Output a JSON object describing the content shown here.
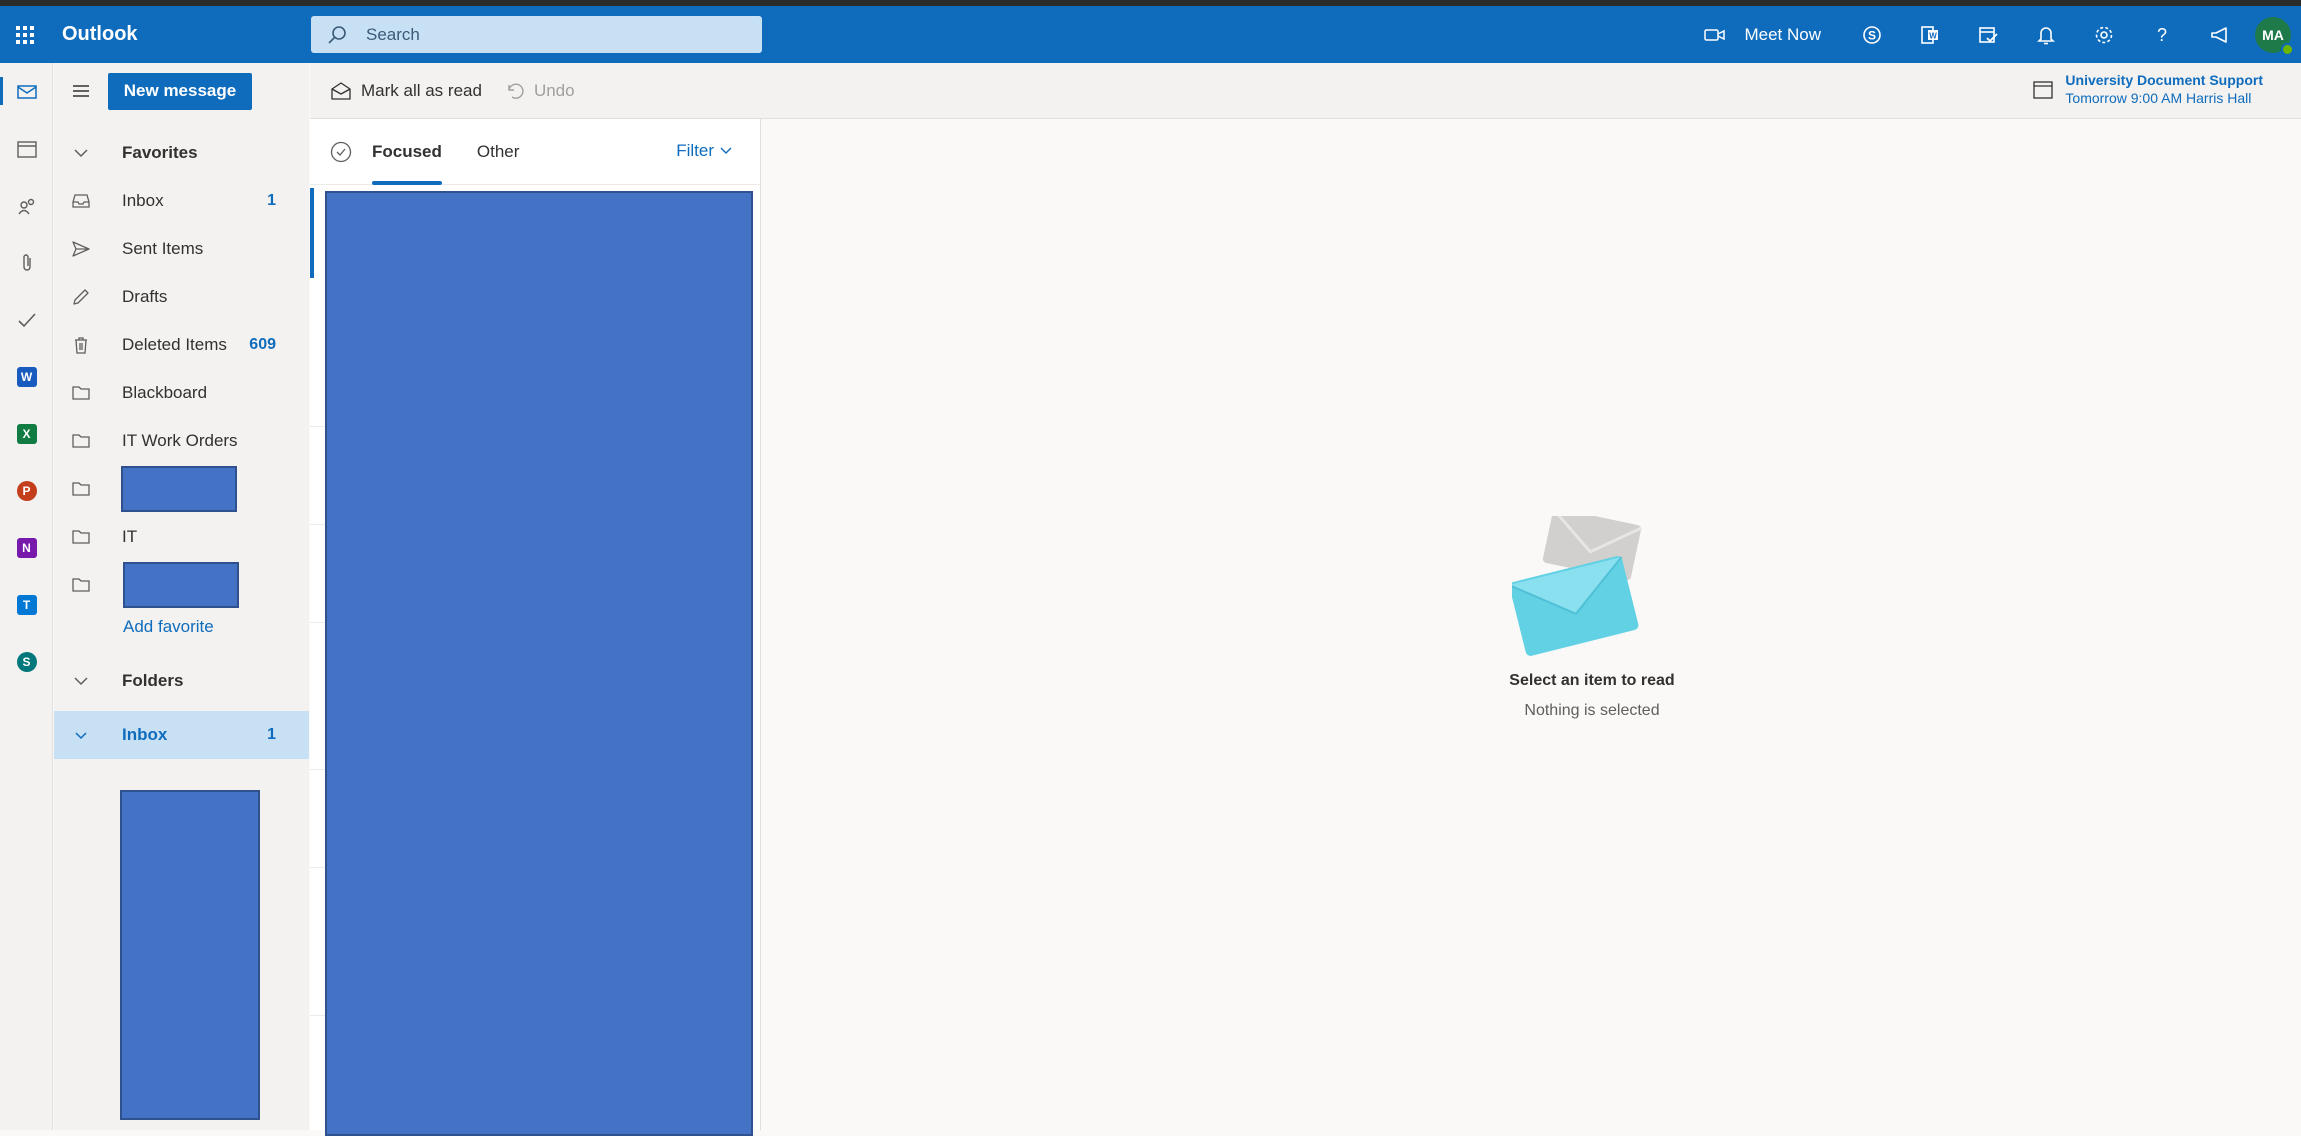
{
  "app": {
    "title": "Outlook"
  },
  "search": {
    "placeholder": "Search"
  },
  "topbar": {
    "meet_now_label": "Meet Now",
    "avatar_initials": "MA"
  },
  "toolbar": {
    "new_message_label": "New message",
    "mark_all_read_label": "Mark all as read",
    "undo_label": "Undo"
  },
  "reminder": {
    "title": "University Document Support",
    "detail": "Tomorrow 9:00 AM Harris Hall"
  },
  "favorites": {
    "heading": "Favorites",
    "items": [
      {
        "label": "Inbox",
        "count": "1"
      },
      {
        "label": "Sent Items",
        "count": ""
      },
      {
        "label": "Drafts",
        "count": ""
      },
      {
        "label": "Deleted Items",
        "count": "609"
      },
      {
        "label": "Blackboard",
        "count": ""
      },
      {
        "label": "IT Work Orders",
        "count": ""
      },
      {
        "label": "",
        "count": ""
      },
      {
        "label": "IT",
        "count": ""
      },
      {
        "label": "",
        "count": ""
      }
    ],
    "add_favorite_label": "Add favorite"
  },
  "folders": {
    "heading": "Folders",
    "inbox": {
      "label": "Inbox",
      "count": "1"
    }
  },
  "message_list": {
    "tabs": {
      "focused": "Focused",
      "other": "Other"
    },
    "filter_label": "Filter"
  },
  "reading_pane": {
    "empty_title": "Select an item to read",
    "empty_subtitle": "Nothing is selected"
  },
  "colors": {
    "brand": "#0f6cbd",
    "redaction": "#4472c4"
  },
  "apps": [
    "mail-icon",
    "calendar-icon",
    "people-icon",
    "files-icon",
    "todo-icon",
    "word-icon",
    "excel-icon",
    "powerpoint-icon",
    "onenote-icon",
    "teams-icon",
    "sharepoint-icon"
  ]
}
